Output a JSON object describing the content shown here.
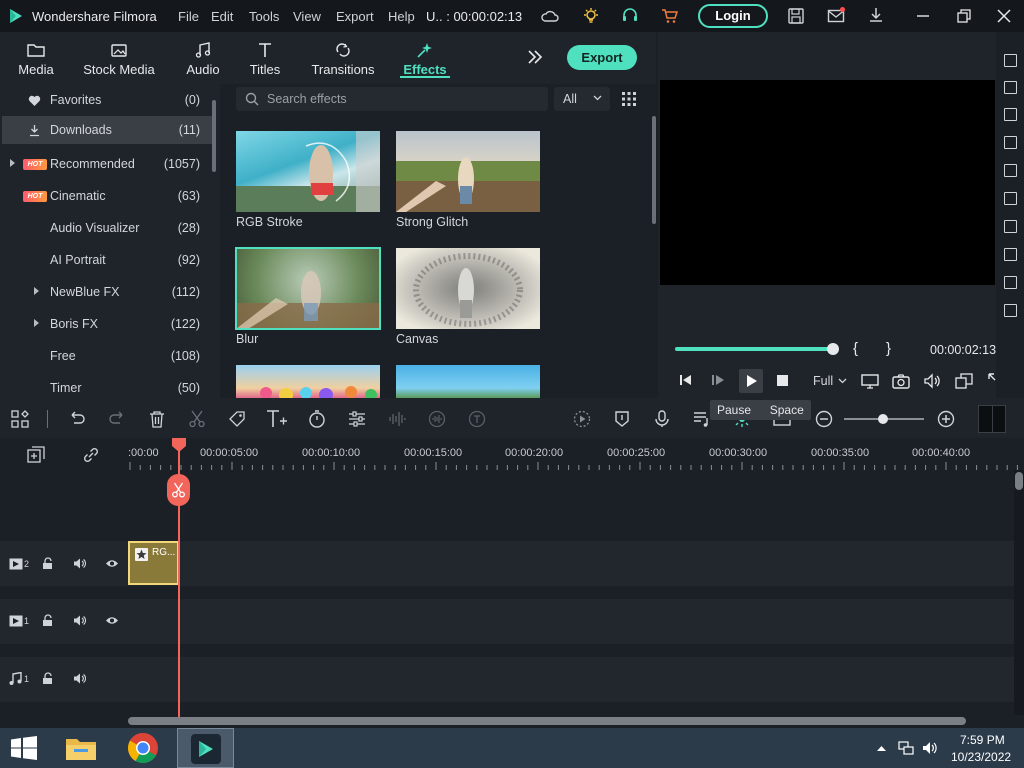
{
  "app": {
    "title": "Wondershare Filmora",
    "project": "U.. : 00:00:02:13"
  },
  "menu": [
    "File",
    "Edit",
    "Tools",
    "View",
    "Export",
    "Help"
  ],
  "login_label": "Login",
  "media_tabs": [
    {
      "label": "Media",
      "icon": "folder-icon"
    },
    {
      "label": "Stock Media",
      "icon": "stock-media-icon"
    },
    {
      "label": "Audio",
      "icon": "music-note-icon"
    },
    {
      "label": "Titles",
      "icon": "text-icon"
    },
    {
      "label": "Transitions",
      "icon": "transitions-icon"
    },
    {
      "label": "Effects",
      "icon": "effects-icon",
      "active": true
    }
  ],
  "export_label": "Export",
  "categories": [
    {
      "label": "Favorites",
      "count": "(0)"
    },
    {
      "label": "Downloads",
      "count": "(11)"
    },
    {
      "label": "Recommended",
      "count": "(1057)"
    },
    {
      "label": "Cinematic",
      "count": "(63)"
    },
    {
      "label": "Audio Visualizer",
      "count": "(28)"
    },
    {
      "label": "AI Portrait",
      "count": "(92)"
    },
    {
      "label": "NewBlue FX",
      "count": "(112)"
    },
    {
      "label": "Boris FX",
      "count": "(122)"
    },
    {
      "label": "Free",
      "count": "(108)"
    },
    {
      "label": "Timer",
      "count": "(50)"
    }
  ],
  "hot_badge": "HOT",
  "search": {
    "placeholder": "Search effects",
    "filter": "All"
  },
  "effects": [
    {
      "label": "RGB Stroke"
    },
    {
      "label": "Strong Glitch"
    },
    {
      "label": "Blur"
    },
    {
      "label": "Canvas"
    }
  ],
  "player": {
    "time": "00:00:02:13",
    "quality": "Full",
    "progress": 1.0,
    "mark_in": "{",
    "mark_out": "}"
  },
  "tooltip": {
    "action": "Pause",
    "shortcut": "Space"
  },
  "timeline": {
    "ticks": [
      ":00:00",
      "00:00:05:00",
      "00:00:10:00",
      "00:00:15:00",
      "00:00:20:00",
      "00:00:25:00",
      "00:00:30:00",
      "00:00:35:00",
      "00:00:40:00"
    ],
    "clip_label": "RG...",
    "tracks": [
      {
        "num": "2"
      },
      {
        "num": "1"
      },
      {
        "num": "1"
      }
    ]
  },
  "taskbar": {
    "time": "7:59 PM",
    "date": "10/23/2022"
  },
  "colors": {
    "accent": "#4fe0c0",
    "playhead": "#f2655b",
    "clip": "#8a7a3a"
  }
}
